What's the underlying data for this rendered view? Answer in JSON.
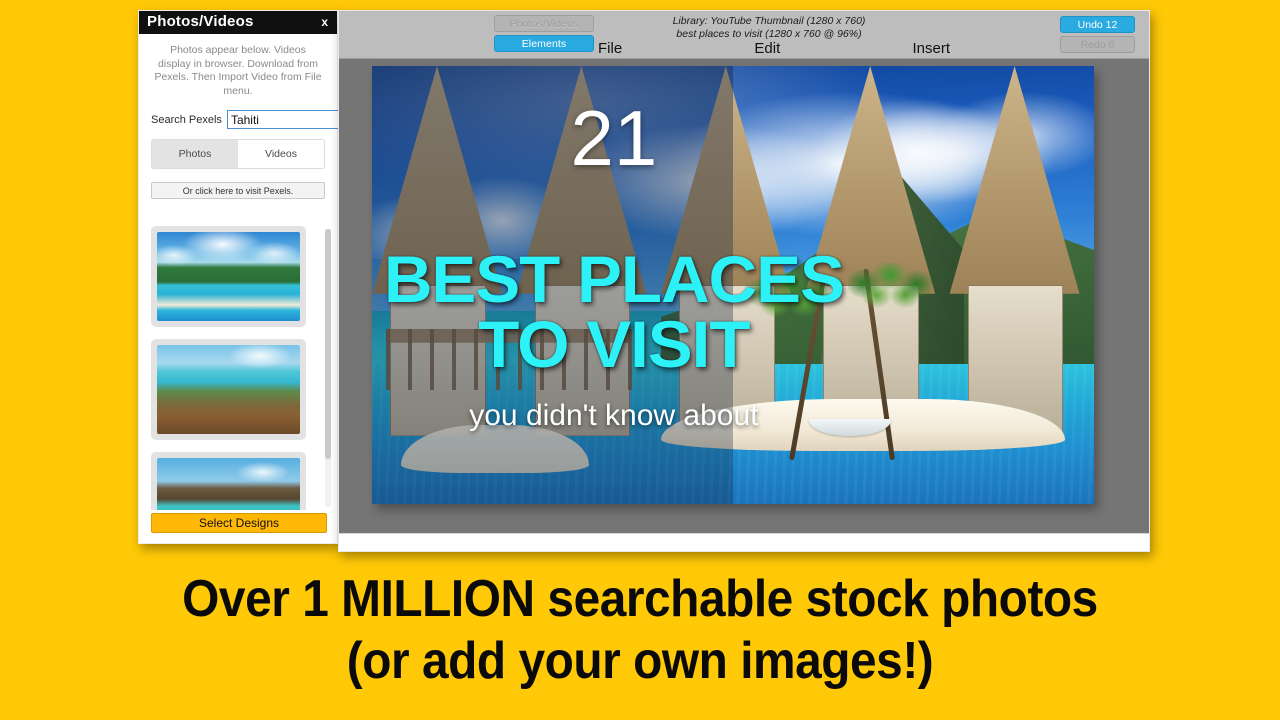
{
  "page": {
    "background_color": "#FFC907"
  },
  "photos_panel": {
    "title": "Photos/Videos",
    "close_label": "x",
    "help_text": "Photos appear below. Videos display in browser. Download from Pexels. Then Import Video from File menu.",
    "search_label": "Search Pexels",
    "search_value": "Tahiti",
    "search_placeholder": "Search Pexels",
    "media_tabs": [
      {
        "label": "Photos",
        "selected": true
      },
      {
        "label": "Videos",
        "selected": false
      }
    ],
    "visit_link_label": "Or click here to visit Pexels.",
    "thumbnails": [
      {
        "alt": "Tropical island peak with overwater bungalows and white sandbar"
      },
      {
        "alt": "Aerial view of turquoise lagoon coastline with vegetation"
      },
      {
        "alt": "Row of thatched overwater bungalows on a turquoise lagoon"
      }
    ],
    "select_designs_label": "Select Designs"
  },
  "editor": {
    "pane_tabs": [
      {
        "label": "Photos/Videos",
        "state": "disabled"
      },
      {
        "label": "Elements",
        "state": "active"
      }
    ],
    "library_line1": "Library: YouTube Thumbnail (1280 x 760)",
    "library_line2": "best places to visit (1280 x 760 @ 96%)",
    "menus": [
      "File",
      "Edit",
      "Insert"
    ],
    "history": [
      {
        "label": "Undo 12",
        "state": "enabled"
      },
      {
        "label": "Redo 0",
        "state": "disabled"
      }
    ],
    "accent_color": "#29ABE2",
    "workspace_color": "#757575"
  },
  "canvas": {
    "thumbnail_text": {
      "number": "21",
      "line1": "BEST PLACES",
      "line2": "TO VISIT",
      "subtitle": "you didn't know about",
      "highlight_color": "#2CF2F7",
      "number_color": "#FFFFFF"
    }
  },
  "caption": {
    "line1": "Over 1 MILLION searchable stock photos",
    "line2": "(or add your own images!)"
  }
}
